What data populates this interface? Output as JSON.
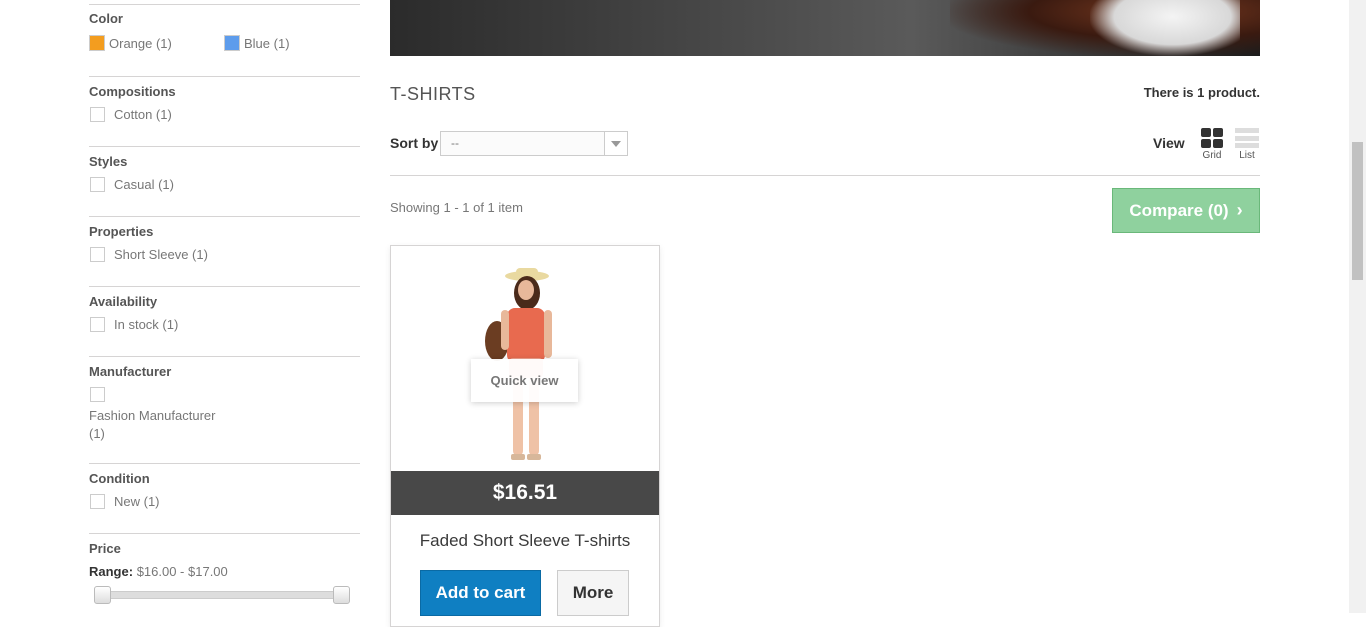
{
  "filters": [
    {
      "title": "Color",
      "type": "color",
      "options": [
        {
          "label": "Orange (1)",
          "color": "#f39d1f"
        },
        {
          "label": "Blue (1)",
          "color": "#5d9cec"
        }
      ]
    },
    {
      "title": "Compositions",
      "options": [
        {
          "label": "Cotton (1)"
        }
      ]
    },
    {
      "title": "Styles",
      "options": [
        {
          "label": "Casual (1)"
        }
      ]
    },
    {
      "title": "Properties",
      "options": [
        {
          "label": "Short Sleeve (1)"
        }
      ]
    },
    {
      "title": "Availability",
      "options": [
        {
          "label": "In stock (1)"
        }
      ]
    },
    {
      "title": "Manufacturer",
      "options": [
        {
          "label_line1": "Fashion Manufacturer",
          "label_line2": "(1)"
        }
      ]
    },
    {
      "title": "Condition",
      "options": [
        {
          "label": "New (1)"
        }
      ]
    }
  ],
  "price": {
    "title": "Price",
    "range_label": "Range:",
    "range_value": "$16.00 - $17.00"
  },
  "category": {
    "title": "T-SHIRTS",
    "count_prefix": "There is ",
    "count_number": "1",
    "count_suffix": " product."
  },
  "sort": {
    "label": "Sort by",
    "selected": "--"
  },
  "view": {
    "label": "View",
    "grid": "Grid",
    "list": "List"
  },
  "showing": "Showing 1 - 1 of 1 item",
  "compare": {
    "label": "Compare (0)",
    "chevron": "›"
  },
  "product": {
    "price": "$16.51",
    "name": "Faded Short Sleeve T-shirts",
    "quick_view": "Quick view",
    "add_to_cart": "Add to cart",
    "more": "More"
  }
}
